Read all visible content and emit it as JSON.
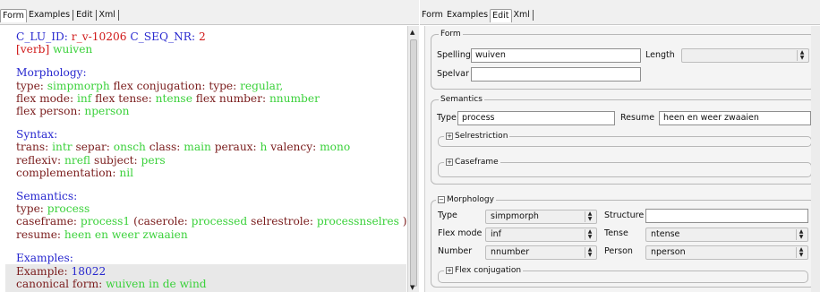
{
  "left_tabs": [
    "Form",
    "Examples",
    "Edit",
    "Xml"
  ],
  "left_active_tab": "Form",
  "right_tabs": [
    "Form",
    "Examples",
    "Edit",
    "Xml"
  ],
  "right_active_tab": "Edit",
  "entry": {
    "id_label": "C_LU_ID:",
    "id_value": "r_v-10206",
    "seq_label": "C_SEQ_NR:",
    "seq_value": "2",
    "pos": "[verb]",
    "lemma": "wuiven"
  },
  "morphology": {
    "heading": "Morphology:",
    "type_label": "type:",
    "type_value": "simpmorph",
    "flexconj_label": "flex conjugation:",
    "flexconj_type_label": "type:",
    "flexconj_type_value": "regular,",
    "flexmode_label": "flex mode:",
    "flexmode_value": "inf",
    "flextense_label": "flex tense:",
    "flextense_value": "ntense",
    "flexnumber_label": "flex number:",
    "flexnumber_value": "nnumber",
    "flexperson_label": "flex person:",
    "flexperson_value": "nperson"
  },
  "syntax": {
    "heading": "Syntax:",
    "trans_label": "trans:",
    "trans_value": "intr",
    "separ_label": "separ:",
    "separ_value": "onsch",
    "class_label": "class:",
    "class_value": "main",
    "peraux_label": "peraux:",
    "peraux_value": "h",
    "valency_label": "valency:",
    "valency_value": "mono",
    "reflexiv_label": "reflexiv:",
    "reflexiv_value": "nrefl",
    "subject_label": "subject:",
    "subject_value": "pers",
    "complementation_label": "complementation:",
    "complementation_value": "nil"
  },
  "semantics": {
    "heading": "Semantics:",
    "type_label": "type:",
    "type_value": "process",
    "caseframe_label": "caseframe:",
    "caseframe_value": "process1",
    "caserole_open": "(caserole:",
    "caserole_value": "processed",
    "selrestrole_label": "selrestrole:",
    "selrestrole_value": "processnselres",
    "close_paren": ")",
    "resume_label": "resume:",
    "resume_value": "heen en weer zwaaien"
  },
  "examples": {
    "heading": "Examples:",
    "example_label": "Example:",
    "example_value": "18022",
    "canonical_label": "canonical form:",
    "canonical_value": "wuiven in de wind"
  },
  "editor": {
    "form_title": "Form",
    "spelling_label": "Spelling",
    "spelling_value": "wuiven",
    "length_label": "Length",
    "length_value": "",
    "spelvar_label": "Spelvar",
    "spelvar_value": "",
    "semantics_title": "Semantics",
    "type_label": "Type",
    "type_value": "process",
    "resume_label": "Resume",
    "resume_value": "heen en weer zwaaien",
    "selrestriction_title": "Selrestriction",
    "caseframe_title": "Caseframe",
    "morphology_title": "Morphology",
    "morph_type_label": "Type",
    "morph_type_value": "simpmorph",
    "structure_label": "Structure",
    "structure_value": "",
    "flexmode_label": "Flex mode",
    "flexmode_value": "inf",
    "tense_label": "Tense",
    "tense_value": "ntense",
    "number_label": "Number",
    "number_value": "nnumber",
    "person_label": "Person",
    "person_value": "nperson",
    "flexconj_title": "Flex conjugation"
  }
}
